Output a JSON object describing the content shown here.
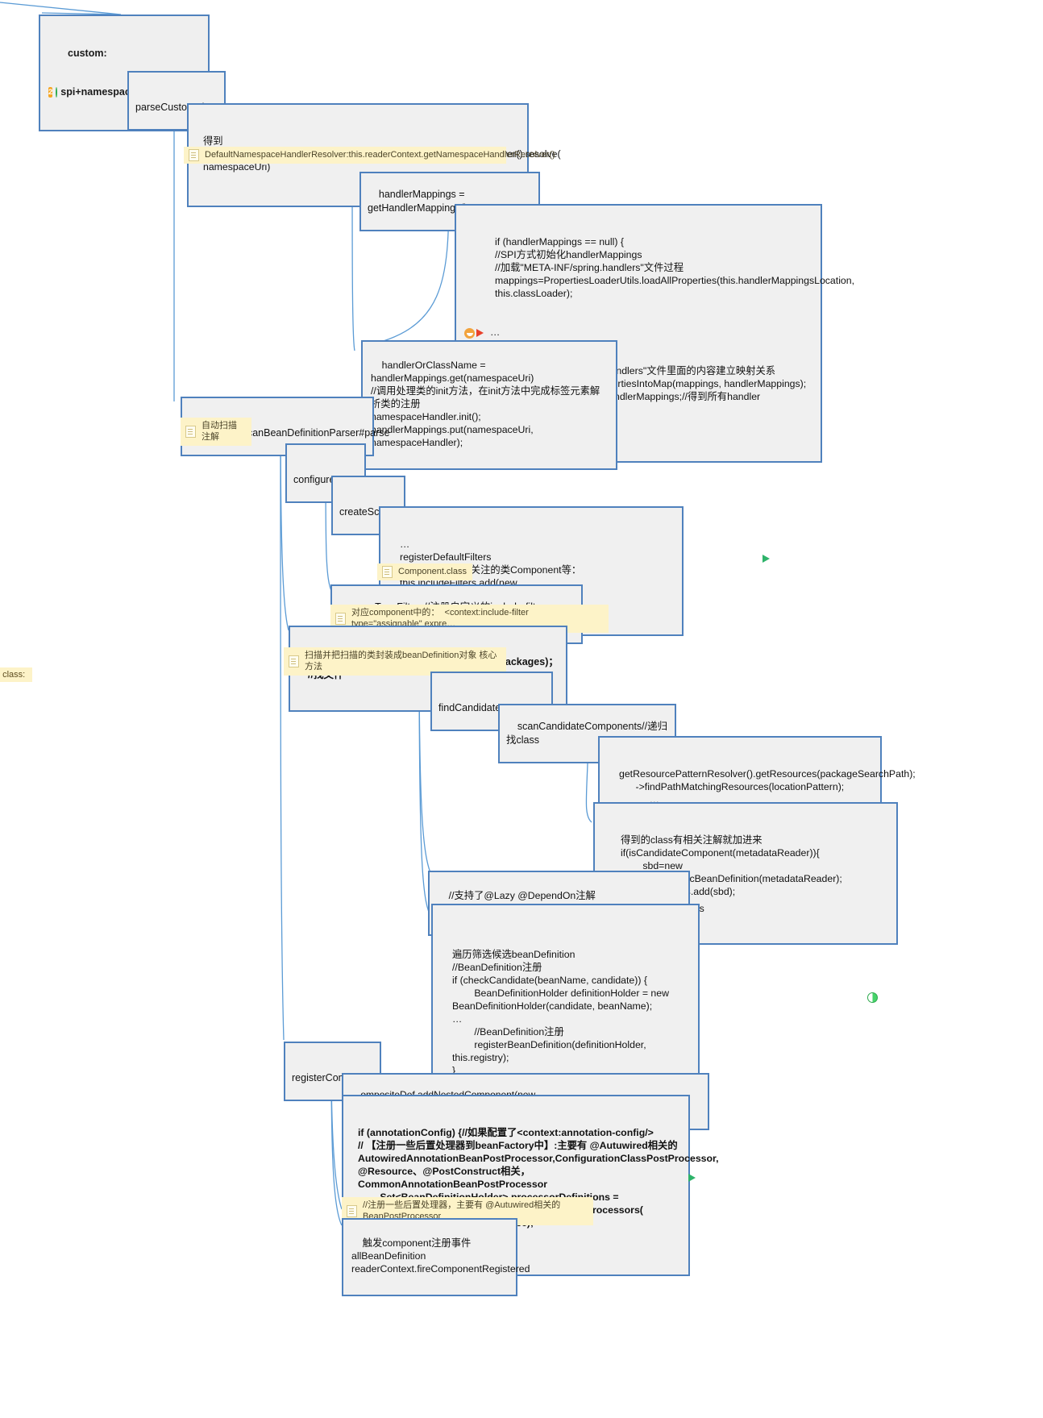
{
  "diagram": {
    "type": "mindmap",
    "title": "custom: spi+namespaceHandler+parser",
    "theme": {
      "node_border": "#4f81bd",
      "node_fill": "#f0f0f0",
      "note_fill": "#fdf3c8",
      "link": "#5b9bd5"
    }
  },
  "root": {
    "line1": "custom:",
    "line2": "spi+namespaceHandler+parser",
    "priority": "2"
  },
  "nodes": {
    "parse_custom_element": "parseCustomElement",
    "resolve_block": "得到\nnamespaceHandler:this.readerContext.getNamespaceHandlerResolver().resolve(\nnamespaceUri)",
    "resolve_note": "DefaultNamespaceHandlerResolver:this.readerContext.getNamespaceHandlerResolver()",
    "handler_mappings": "handlerMappings = getHandlerMappings();",
    "handler_mappings_block_a": "if (handlerMappings == null) {\n//SPI方式初始化handlerMappings\n//加载\"META-INF/spring.handlers\"文件过程\nmappings=PropertiesLoaderUtils.loadAllProperties(this.handlerMappingsLocation,\nthis.classLoader);",
    "handler_mappings_block_b": "…",
    "handler_mappings_block_c": " //所有\"META-INF/spring.handlers\"文件里面的内容建立映射关系\n CollectionUtils.mergePropertiesIntoMap(mappings, handlerMappings);\n this.handlerMappings = handlerMappings;//得到所有handler\n }\n return handlerMappings;",
    "handler_or_class_name": "handlerOrClassName = handlerMappings.get(namespaceUri)\n//调用处理类的init方法，在init方法中完成标签元素解析类的注册\nnamespaceHandler.init();\nhandlerMappings.put(namespaceUri, namespaceHandler);",
    "component_scan_parser": "ComponentScanBeanDefinitionParser#parse",
    "component_scan_note": "自动扫描注解",
    "configure_scanner": "configureScanner",
    "create_scanner": "createScanner",
    "register_default_filters": "…\nregisterDefaultFilters\n        ->设置默认关注的类Component等：this.includeFilters.add(new\nAnnotationTypeFilter(Component.class));",
    "component_class_note": "Component.class",
    "parse_type_filters": "parseTypeFilters//注册自定义的include-filter，exclude-filter",
    "parse_type_filters_note": "对应component中的：  <context:include-filter type=\"assignable\" expre…",
    "bean_definitions": "beanDefinitions = scanner.doScan(basePackages)； //找文件",
    "bean_definitions_note": "扫描并把扫描的类封装成beanDefinition对象 核心方法",
    "find_candidate_components": "findCandidateComponents",
    "scan_candidate_components": "scanCandidateComponents//递归找class",
    "get_resources_block": "getResourcePatternResolver().getResources(packageSearchPath);\n      ->findPathMatchingResources(locationPattern);\n           …\n           ->递归得到所有关注的class：\n                     得到文件doRetrieveMatchingFiles",
    "is_candidate_block": "得到的class有相关注解就加进来\nif(isCandidateComponent(metadataReader)){\n        sbd=new ScannedGenericBeanDefinition(metadataReader);\n        candidates.add(sbd);\n}",
    "lazy_dependson": "//支持了@Lazy @DependOn注解\nAnnotationConfigUtils.processCommonDefinitionAnnotations",
    "traverse_block": "遍历筛选候选beanDefinition\n//BeanDefinition注册\nif (checkCandidate(beanName, candidate)) {\n        BeanDefinitionHolder definitionHolder = new\nBeanDefinitionHolder(candidate, beanName);\n…\n        //BeanDefinition注册\n        registerBeanDefinition(definitionHolder, this.registry);\n}",
    "register_components": "registerComponents",
    "composite_def": "ompositeDef.addNestedComponent(new BeanComponentDefinition(beanDefHolder)); //",
    "annotation_config_block": "if (annotationConfig) {//如果配置了<context:annotation-config/>\n// 【注册一些后置处理器到beanFactory中】:主要有 @Autuwired相关的\nAutowiredAnnotationBeanPostProcessor,ConfigurationClassPostProcessor,\n@Resource、@PostConstruct相关，CommonAnnotationBeanPostProcessor\n        Set<BeanDefinitionHolder> processorDefinitions =\nAnnotationConfigUtils.registerAnnotationConfigProcessors(\nreaderContext.getRegistry(), source);\n}",
    "annotation_config_note": "//注册一些后置处理器，主要有 @Autuwired相关的BeanPostProcessor",
    "fire_component_registered": "触发component注册事件 allBeanDefinition\nreaderContext.fireComponentRegistered",
    "stray_left": "o\" class:"
  },
  "markers": {
    "priority2": "2",
    "progress_icon": "progress-icon",
    "green_flag": "green-flag-icon",
    "red_flag": "red-flag-icon",
    "smiley": "smiley-icon",
    "note_doc": "note-icon"
  }
}
